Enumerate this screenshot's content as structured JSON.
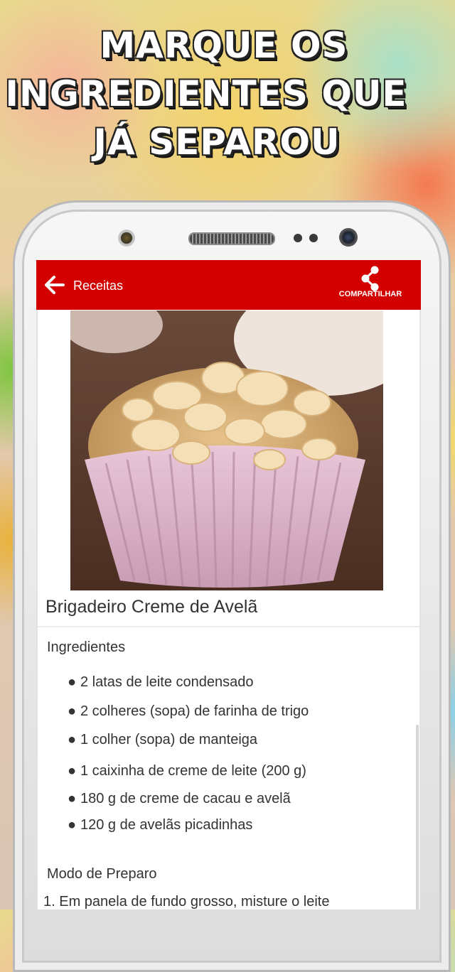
{
  "headline": {
    "line1": "MARQUE OS",
    "line2": "INGREDIENTES QUE",
    "line3": "JÁ SEPAROU"
  },
  "appbar": {
    "title": "Receitas",
    "share_label": "COMPARTILHAR",
    "color": "#d30000"
  },
  "recipe": {
    "title": "Brigadeiro Creme de Avelã",
    "ingredients_heading": "Ingredientes",
    "ingredients": [
      "2 latas de leite condensado",
      "2 colheres (sopa) de farinha de trigo",
      "1 colher (sopa) de manteiga",
      "1 caixinha de creme de leite (200 g)",
      "180 g de creme de cacau e avelã",
      "120 g de avelãs picadinhas"
    ],
    "bullet": "●",
    "preparation_heading": "Modo de Preparo",
    "steps": [
      "1. Em panela de fundo grosso, misture o leite"
    ]
  }
}
